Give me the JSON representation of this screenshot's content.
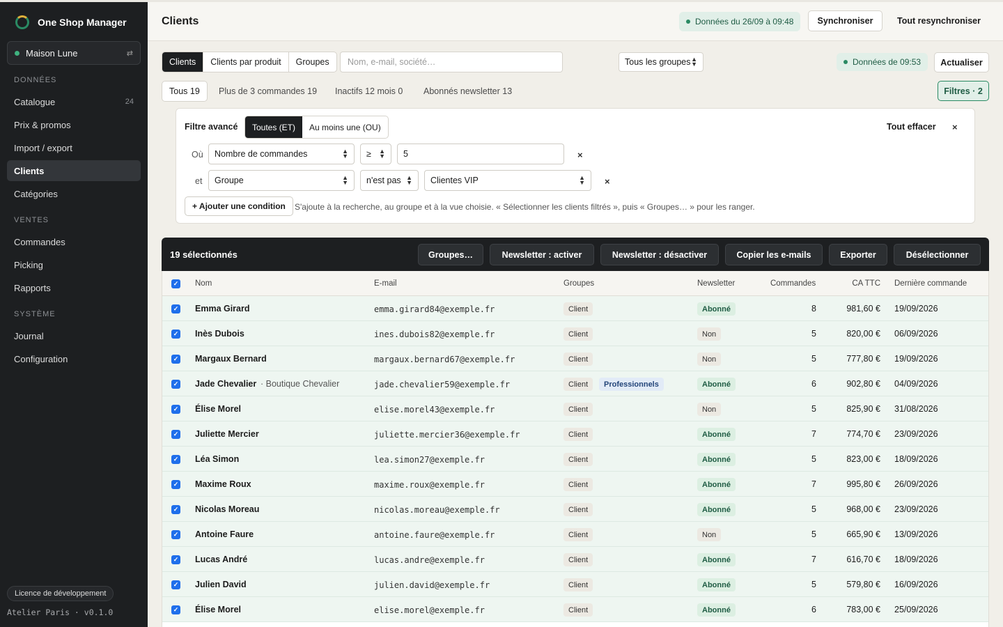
{
  "app": {
    "name": "One Shop Manager",
    "shop": "Maison Lune",
    "license": "Licence de développement",
    "org": "Atelier Paris · v0.1.0"
  },
  "nav": {
    "sections": [
      {
        "title": "DONNÉES",
        "items": [
          {
            "label": "Catalogue",
            "count": "24"
          },
          {
            "label": "Prix & promos",
            "count": ""
          },
          {
            "label": "Import / export",
            "count": ""
          },
          {
            "label": "Clients",
            "count": "",
            "active": true
          },
          {
            "label": "Catégories",
            "count": ""
          }
        ]
      },
      {
        "title": "VENTES",
        "items": [
          {
            "label": "Commandes",
            "count": ""
          },
          {
            "label": "Picking",
            "count": ""
          },
          {
            "label": "Rapports",
            "count": ""
          }
        ]
      },
      {
        "title": "SYSTÈME",
        "items": [
          {
            "label": "Journal",
            "count": ""
          },
          {
            "label": "Configuration",
            "count": ""
          }
        ]
      }
    ]
  },
  "header": {
    "title": "Clients",
    "data_status": "Données du 26/09 à 09:48",
    "sync_label": "Synchroniser",
    "resync_label": "Tout resynchroniser"
  },
  "toolbar": {
    "tabs": [
      "Clients",
      "Clients par produit",
      "Groupes"
    ],
    "search_placeholder": "Nom, e-mail, société…",
    "group_select": "Tous les groupes",
    "data_status": "Données de 09:53",
    "refresh_label": "Actualiser"
  },
  "quick_filters": [
    {
      "label": "Tous 19",
      "active": true
    },
    {
      "label": "Plus de 3 commandes 19"
    },
    {
      "label": "Inactifs 12 mois 0"
    },
    {
      "label": "Abonnés newsletter 13"
    }
  ],
  "filters_button": "Filtres · 2",
  "advanced_filter": {
    "title": "Filtre avancé",
    "modes": [
      "Toutes (ET)",
      "Au moins une (OU)"
    ],
    "clear_label": "Tout effacer",
    "close_label": "×",
    "conditions": [
      {
        "prefix": "Où",
        "field": "Nombre de commandes",
        "operator": "≥",
        "value": "5",
        "remove": "×"
      },
      {
        "prefix": "et",
        "field": "Groupe",
        "operator": "n'est pas",
        "value": "Clientes VIP",
        "remove": "×"
      }
    ],
    "add_label": "+ Ajouter une condition",
    "hint": "S'ajoute à la recherche, au groupe et à la vue choisie. « Sélectionner les clients filtrés », puis « Groupes… » pour les ranger."
  },
  "selection": {
    "count_label": "19 sélectionnés",
    "actions": [
      "Groupes…",
      "Newsletter : activer",
      "Newsletter : désactiver",
      "Copier les e-mails",
      "Exporter",
      "Désélectionner"
    ]
  },
  "table": {
    "columns": [
      "Nom",
      "E-mail",
      "Groupes",
      "Newsletter",
      "Commandes",
      "CA TTC",
      "Dernière commande"
    ],
    "rows": [
      {
        "name": "Emma Girard",
        "company": "",
        "email": "emma.girard84@exemple.fr",
        "groups": [
          "Client"
        ],
        "newsletter": "Abonné",
        "orders": "8",
        "revenue": "981,60 €",
        "last": "19/09/2026"
      },
      {
        "name": "Inès Dubois",
        "company": "",
        "email": "ines.dubois82@exemple.fr",
        "groups": [
          "Client"
        ],
        "newsletter": "Non",
        "orders": "5",
        "revenue": "820,00 €",
        "last": "06/09/2026"
      },
      {
        "name": "Margaux Bernard",
        "company": "",
        "email": "margaux.bernard67@exemple.fr",
        "groups": [
          "Client"
        ],
        "newsletter": "Non",
        "orders": "5",
        "revenue": "777,80 €",
        "last": "19/09/2026"
      },
      {
        "name": "Jade Chevalier",
        "company": "· Boutique Chevalier",
        "email": "jade.chevalier59@exemple.fr",
        "groups": [
          "Client",
          "Professionnels"
        ],
        "newsletter": "Abonné",
        "orders": "6",
        "revenue": "902,80 €",
        "last": "04/09/2026"
      },
      {
        "name": "Élise Morel",
        "company": "",
        "email": "elise.morel43@exemple.fr",
        "groups": [
          "Client"
        ],
        "newsletter": "Non",
        "orders": "5",
        "revenue": "825,90 €",
        "last": "31/08/2026"
      },
      {
        "name": "Juliette Mercier",
        "company": "",
        "email": "juliette.mercier36@exemple.fr",
        "groups": [
          "Client"
        ],
        "newsletter": "Abonné",
        "orders": "7",
        "revenue": "774,70 €",
        "last": "23/09/2026"
      },
      {
        "name": "Léa Simon",
        "company": "",
        "email": "lea.simon27@exemple.fr",
        "groups": [
          "Client"
        ],
        "newsletter": "Abonné",
        "orders": "5",
        "revenue": "823,00 €",
        "last": "18/09/2026"
      },
      {
        "name": "Maxime Roux",
        "company": "",
        "email": "maxime.roux@exemple.fr",
        "groups": [
          "Client"
        ],
        "newsletter": "Abonné",
        "orders": "7",
        "revenue": "995,80 €",
        "last": "26/09/2026"
      },
      {
        "name": "Nicolas Moreau",
        "company": "",
        "email": "nicolas.moreau@exemple.fr",
        "groups": [
          "Client"
        ],
        "newsletter": "Abonné",
        "orders": "5",
        "revenue": "968,00 €",
        "last": "23/09/2026"
      },
      {
        "name": "Antoine Faure",
        "company": "",
        "email": "antoine.faure@exemple.fr",
        "groups": [
          "Client"
        ],
        "newsletter": "Non",
        "orders": "5",
        "revenue": "665,90 €",
        "last": "13/09/2026"
      },
      {
        "name": "Lucas André",
        "company": "",
        "email": "lucas.andre@exemple.fr",
        "groups": [
          "Client"
        ],
        "newsletter": "Abonné",
        "orders": "7",
        "revenue": "616,70 €",
        "last": "18/09/2026"
      },
      {
        "name": "Julien David",
        "company": "",
        "email": "julien.david@exemple.fr",
        "groups": [
          "Client"
        ],
        "newsletter": "Abonné",
        "orders": "5",
        "revenue": "579,80 €",
        "last": "16/09/2026"
      },
      {
        "name": "Élise Morel",
        "company": "",
        "email": "elise.morel@exemple.fr",
        "groups": [
          "Client"
        ],
        "newsletter": "Abonné",
        "orders": "6",
        "revenue": "783,00 €",
        "last": "25/09/2026"
      }
    ]
  }
}
